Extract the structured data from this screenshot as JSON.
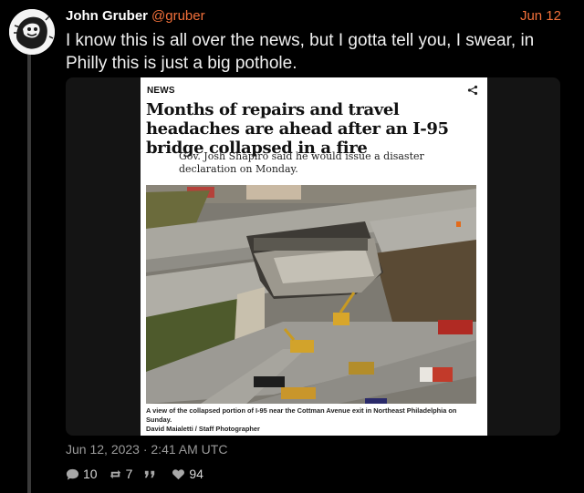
{
  "post": {
    "author_name": "John Gruber",
    "author_handle": "@gruber",
    "date_short": "Jun 12",
    "text": "I know this is all over the news, but I gotta tell you, I swear, in Philly this is just a big pothole.",
    "timestamp": "Jun 12, 2023 · 2:41 AM UTC"
  },
  "article": {
    "section": "NEWS",
    "headline": "Months of repairs and travel headaches are ahead after an I-95 bridge collapsed in a fire",
    "subhead": "Gov. Josh Shapiro said he would issue a disaster declaration on Monday.",
    "caption_line1": "A view of the collapsed portion of I-95 near the Cottman Avenue exit in Northeast Philadelphia on Sunday.",
    "caption_line2": "David Maialetti / Staff Photographer"
  },
  "stats": {
    "replies": "10",
    "reposts": "7",
    "quotes": "",
    "likes": "94"
  },
  "colors": {
    "accent": "#f2703a",
    "background": "#000000"
  },
  "icons": [
    "reply-icon",
    "repost-icon",
    "quote-icon",
    "like-icon",
    "share-icon"
  ]
}
